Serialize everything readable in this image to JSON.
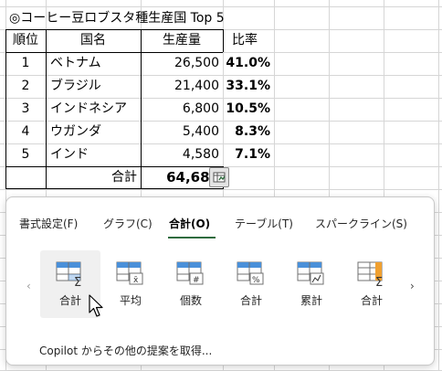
{
  "title": "◎コーヒー豆ロブスタ種生産国 Top 5",
  "table": {
    "headers": [
      "順位",
      "国名",
      "生産量",
      "比率"
    ],
    "rows": [
      {
        "rank": "1",
        "country": "ベトナム",
        "production": "26,500",
        "ratio": "41.0%"
      },
      {
        "rank": "2",
        "country": "ブラジル",
        "production": "21,400",
        "ratio": "33.1%"
      },
      {
        "rank": "3",
        "country": "インドネシア",
        "production": "6,800",
        "ratio": "10.5%"
      },
      {
        "rank": "4",
        "country": "ウガンダ",
        "production": "5,400",
        "ratio": "8.3%"
      },
      {
        "rank": "5",
        "country": "インド",
        "production": "4,580",
        "ratio": "7.1%"
      }
    ],
    "total_label": "合計",
    "total_value": "64,680"
  },
  "quick_analysis": {
    "tabs": [
      {
        "label": "書式設定(F)",
        "active": false
      },
      {
        "label": "グラフ(C)",
        "active": false
      },
      {
        "label": "合計(O)",
        "active": true
      },
      {
        "label": "テーブル(T)",
        "active": false
      },
      {
        "label": "スパークライン(S)",
        "active": false
      }
    ],
    "items": [
      {
        "label": "合計",
        "icon": "sum-icon"
      },
      {
        "label": "平均",
        "icon": "average-icon"
      },
      {
        "label": "個数",
        "icon": "count-icon"
      },
      {
        "label": "合計",
        "icon": "percent-total-icon"
      },
      {
        "label": "累計",
        "icon": "running-total-icon"
      },
      {
        "label": "合計",
        "icon": "column-sum-icon"
      }
    ],
    "nav_prev": "‹",
    "nav_next": "›",
    "copilot_link": "Copilot からその他の提案を取得..."
  },
  "colors": {
    "accent": "#2f6b3e",
    "icon_blue": "#4a90d9",
    "icon_orange": "#f0a030"
  }
}
